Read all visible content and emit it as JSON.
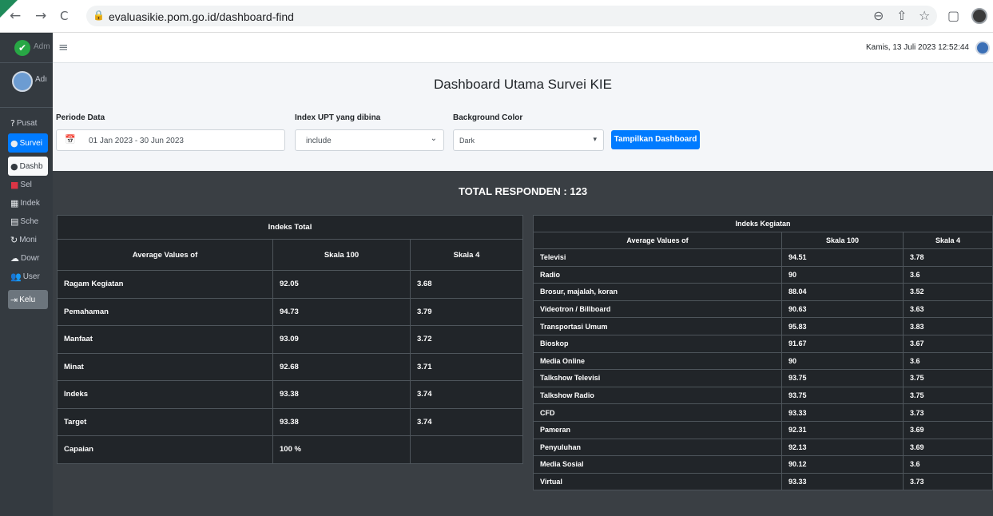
{
  "browser": {
    "url": "evaluasikie.pom.go.id/dashboard-find",
    "back_icon": "←",
    "forward_icon": "→",
    "reload_icon": "C",
    "lock_icon": "🔒",
    "zoom_icon": "⊖",
    "share_icon": "⇧",
    "star_icon": "☆",
    "sidebar_icon": "▢"
  },
  "sidebar": {
    "brand": "Adm",
    "brand_icon": "✔",
    "user": "Adı",
    "items": [
      {
        "label": "Pusat",
        "icon": "?"
      },
      {
        "label": "Survei",
        "icon": "●"
      },
      {
        "label": "Dashb",
        "icon": "●"
      },
      {
        "label": "Sel",
        "icon": "■"
      },
      {
        "label": "Indek",
        "icon": "▦"
      },
      {
        "label": "Sche",
        "icon": "▤"
      },
      {
        "label": "Moni",
        "icon": "↻"
      },
      {
        "label": "Dowr",
        "icon": "☁"
      },
      {
        "label": "User",
        "icon": "👥"
      },
      {
        "label": "Kelu",
        "icon": "⇥"
      }
    ]
  },
  "topbar": {
    "menu_icon": "≡",
    "datetime": "Kamis, 13 Juli 2023 12:52:44"
  },
  "dashboard": {
    "title": "Dashboard Utama Survei KIE",
    "periode_label": "Periode Data",
    "periode_icon": "📅",
    "periode_value": "01 Jan 2023 - 30 Jun 2023",
    "upt_label": "Index UPT yang dibina",
    "upt_value": "include",
    "bg_label": "Background Color",
    "bg_value": "Dark",
    "chevron": "⌄",
    "chevron_small": "▾",
    "show_button": "Tampilkan Dashboard",
    "total_responden": "TOTAL RESPONDEN : 123"
  },
  "indeks_total": {
    "caption": "Indeks Total",
    "headers": [
      "Average Values of",
      "Skala 100",
      "Skala 4"
    ],
    "rows": [
      [
        "Ragam Kegiatan",
        "92.05",
        "3.68"
      ],
      [
        "Pemahaman",
        "94.73",
        "3.79"
      ],
      [
        "Manfaat",
        "93.09",
        "3.72"
      ],
      [
        "Minat",
        "92.68",
        "3.71"
      ],
      [
        "Indeks",
        "93.38",
        "3.74"
      ],
      [
        "Target",
        "93.38",
        "3.74"
      ],
      [
        "Capaian",
        "100 %",
        ""
      ]
    ]
  },
  "indeks_kegiatan": {
    "caption": "Indeks Kegiatan",
    "headers": [
      "Average Values of",
      "Skala 100",
      "Skala 4"
    ],
    "rows": [
      [
        "Televisi",
        "94.51",
        "3.78"
      ],
      [
        "Radio",
        "90",
        "3.6"
      ],
      [
        "Brosur, majalah, koran",
        "88.04",
        "3.52"
      ],
      [
        "Videotron / Billboard",
        "90.63",
        "3.63"
      ],
      [
        "Transportasi Umum",
        "95.83",
        "3.83"
      ],
      [
        "Bioskop",
        "91.67",
        "3.67"
      ],
      [
        "Media Online",
        "90",
        "3.6"
      ],
      [
        "Talkshow Televisi",
        "93.75",
        "3.75"
      ],
      [
        "Talkshow Radio",
        "93.75",
        "3.75"
      ],
      [
        "CFD",
        "93.33",
        "3.73"
      ],
      [
        "Pameran",
        "92.31",
        "3.69"
      ],
      [
        "Penyuluhan",
        "92.13",
        "3.69"
      ],
      [
        "Media Sosial",
        "90.12",
        "3.6"
      ],
      [
        "Virtual",
        "93.33",
        "3.73"
      ]
    ]
  }
}
